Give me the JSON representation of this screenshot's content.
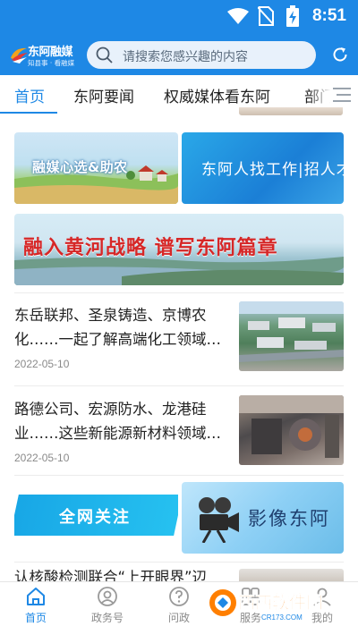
{
  "status_bar": {
    "time": "8:51",
    "icons": [
      "wifi-icon",
      "no-sim-icon",
      "battery-charging-icon"
    ]
  },
  "app": {
    "logo_name": "东阿融媒",
    "logo_slogan": "知县事 · 看融媒",
    "search_placeholder": "请搜索您感兴趣的内容",
    "search_icon": "search-icon",
    "refresh_icon": "refresh-icon",
    "accent_color": "#1e88e5"
  },
  "tabs": {
    "items": [
      {
        "label": "首页",
        "active": true
      },
      {
        "label": "东阿要闻",
        "active": false
      },
      {
        "label": "权威媒体看东阿",
        "active": false
      },
      {
        "label": "部门",
        "active": false
      }
    ],
    "menu_icon": "menu-icon"
  },
  "banners": {
    "rural_revitalization": "融媒心选&助农",
    "talent_recruitment": "东阿人找工作|招人才",
    "yellow_river": "融入黄河战略  谱写东阿篇章",
    "all_network_focus": "全网关注",
    "video_dong_e": "影像东阿"
  },
  "news": [
    {
      "title": "东岳联邦、圣泉铸造、京博农化……一起了解高端化工领域…",
      "date": "2022-05-10"
    },
    {
      "title": "路德公司、宏源防水、龙港硅业……这些新能源新材料领域…",
      "date": "2022-05-10"
    },
    {
      "title": "认核酸检测联合“上开眼界”辺",
      "date": ""
    }
  ],
  "bottom_nav": [
    {
      "label": "首页",
      "icon": "home-icon",
      "active": true
    },
    {
      "label": "政务号",
      "icon": "government-account-icon",
      "active": false
    },
    {
      "label": "问政",
      "icon": "inquiry-icon",
      "active": false
    },
    {
      "label": "服务",
      "icon": "service-icon",
      "active": false
    },
    {
      "label": "我的",
      "icon": "profile-icon",
      "active": false
    }
  ],
  "watermark": {
    "text": "西西软件园",
    "url_text": "CR173.COM"
  }
}
